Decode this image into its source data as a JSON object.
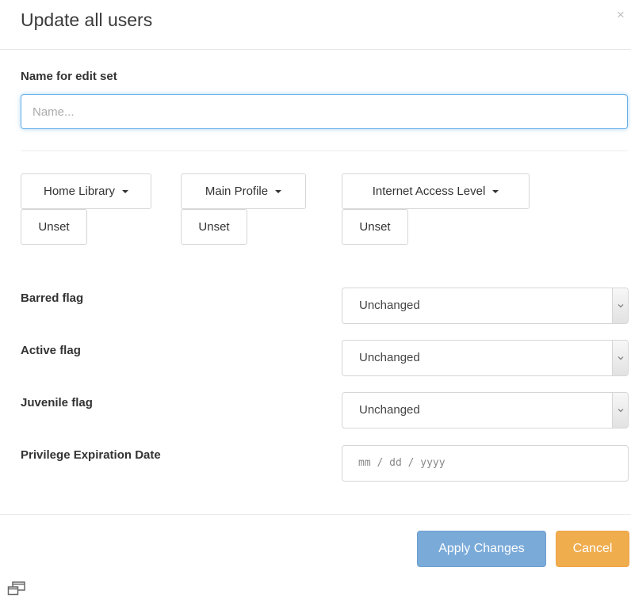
{
  "modal": {
    "title": "Update all users",
    "close_symbol": "×",
    "close_icon": "close-icon"
  },
  "name_field": {
    "label": "Name for edit set",
    "placeholder": "Name...",
    "value": ""
  },
  "dropdowns": [
    {
      "label": "Home Library",
      "unset_label": "Unset"
    },
    {
      "label": "Main Profile",
      "unset_label": "Unset"
    },
    {
      "label": "Internet Access Level",
      "unset_label": "Unset"
    }
  ],
  "flags": [
    {
      "label": "Barred flag",
      "value": "Unchanged"
    },
    {
      "label": "Active flag",
      "value": "Unchanged"
    },
    {
      "label": "Juvenile flag",
      "value": "Unchanged"
    }
  ],
  "expiration": {
    "label": "Privilege Expiration Date",
    "placeholder": "mm / dd / yyyy"
  },
  "footer": {
    "apply_label": "Apply Changes",
    "cancel_label": "Cancel"
  },
  "colors": {
    "focus_border": "#66afe9",
    "apply_button": "#7aaad8",
    "cancel_button": "#f0ad4e"
  },
  "icons": {
    "caret": "caret-down-icon",
    "select_arrow": "chevron-down-icon",
    "popout": "popout-window-icon"
  }
}
